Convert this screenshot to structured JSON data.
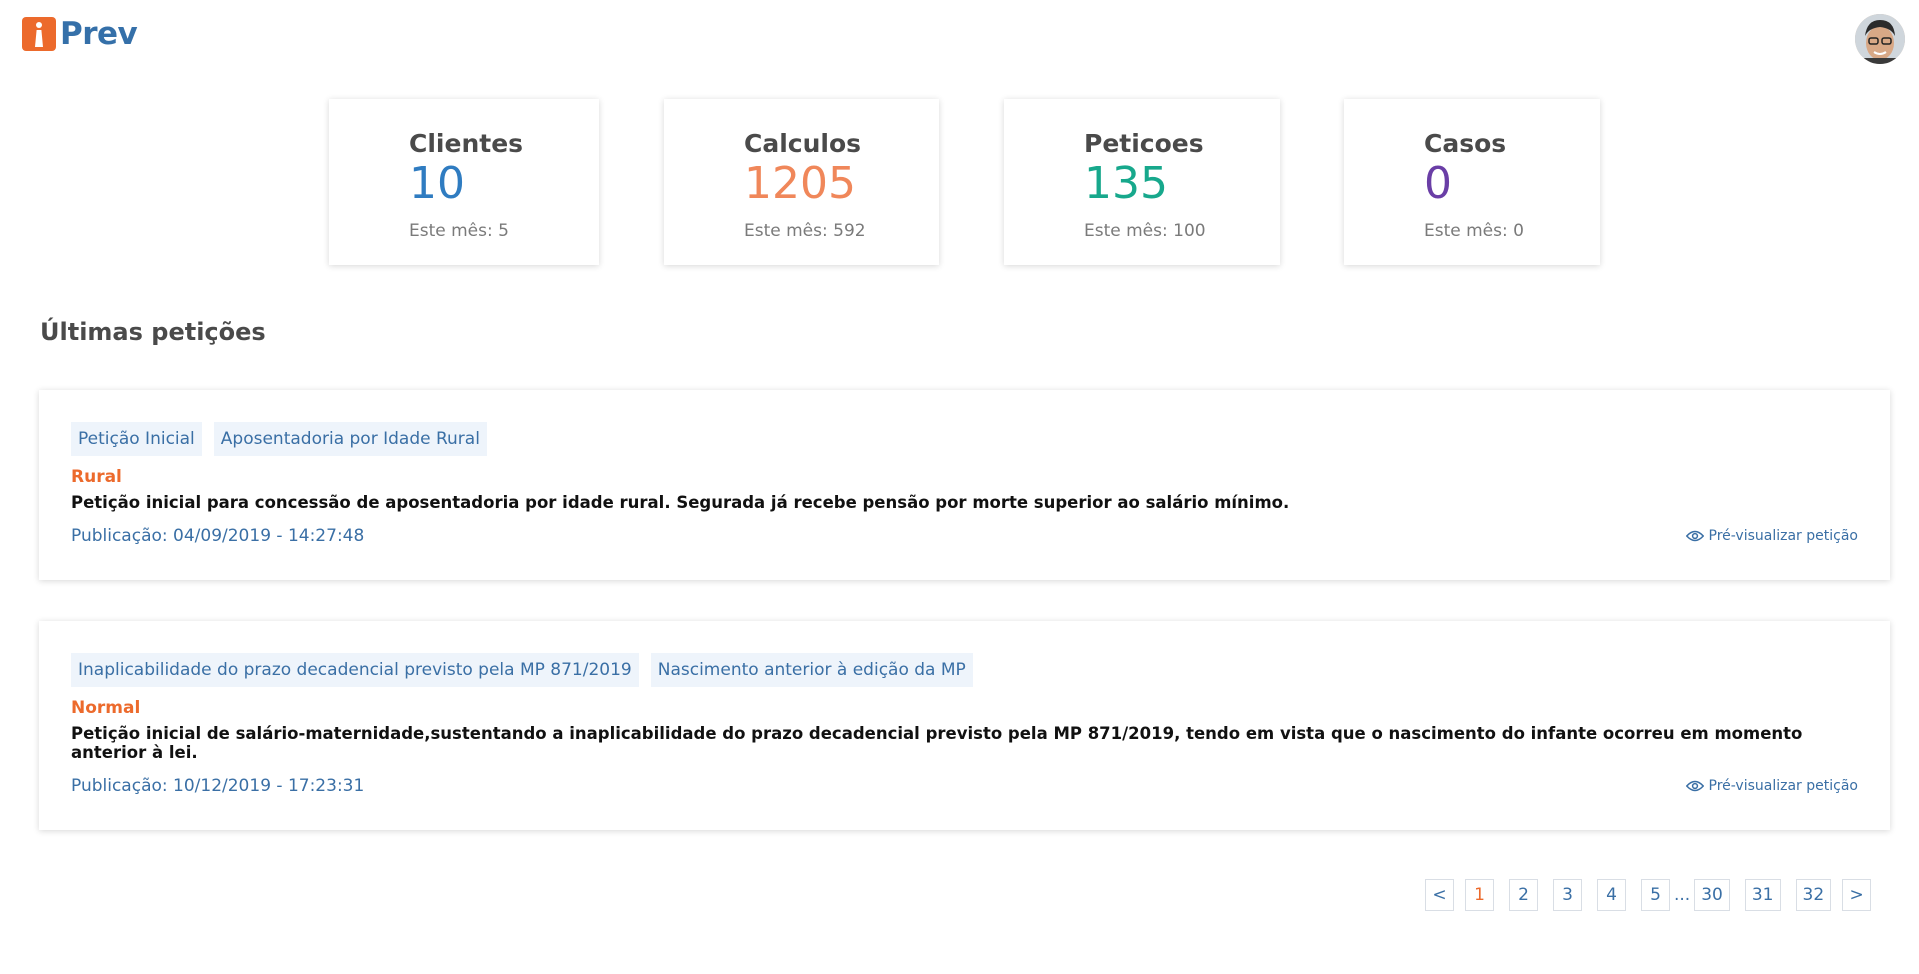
{
  "header": {
    "logo_text": "Prev",
    "brand_color": "#ec6a2c",
    "logo_text_color": "#3570a9"
  },
  "stats": [
    {
      "label": "Clientes",
      "value": "10",
      "sub": "Este mês: 5",
      "color": "#2f7cc1"
    },
    {
      "label": "Calculos",
      "value": "1205",
      "sub": "Este mês: 592",
      "color": "#f0875a"
    },
    {
      "label": "Peticoes",
      "value": "135",
      "sub": "Este mês: 100",
      "color": "#17a88c"
    },
    {
      "label": "Casos",
      "value": "0",
      "sub": "Este mês: 0",
      "color": "#6a3ea6"
    }
  ],
  "section_title": "Últimas petições",
  "petitions": [
    {
      "tags": [
        "Petição Inicial",
        "Aposentadoria por Idade Rural"
      ],
      "type": "Rural",
      "description": "Petição inicial para concessão de aposentadoria por idade rural. Segurada já recebe pensão por morte superior ao salário mínimo.",
      "published": "Publicação: 04/09/2019 - 14:27:48",
      "preview_label": "Pré-visualizar petição"
    },
    {
      "tags": [
        "Inaplicabilidade do prazo decadencial previsto pela MP 871/2019",
        "Nascimento anterior à edição da MP"
      ],
      "type": "Normal",
      "description": "Petição inicial de salário-maternidade,sustentando a inaplicabilidade do prazo decadencial previsto pela MP 871/2019, tendo em vista que o nascimento do infante ocorreu em momento anterior à lei.",
      "published": "Publicação: 10/12/2019 - 17:23:31",
      "preview_label": "Pré-visualizar petição"
    }
  ],
  "pagination": {
    "prev": "<",
    "next": ">",
    "pages_start": [
      "1",
      "2",
      "3",
      "4",
      "5"
    ],
    "ellipsis": "...",
    "pages_end": [
      "30",
      "31",
      "32"
    ],
    "current": "1"
  }
}
